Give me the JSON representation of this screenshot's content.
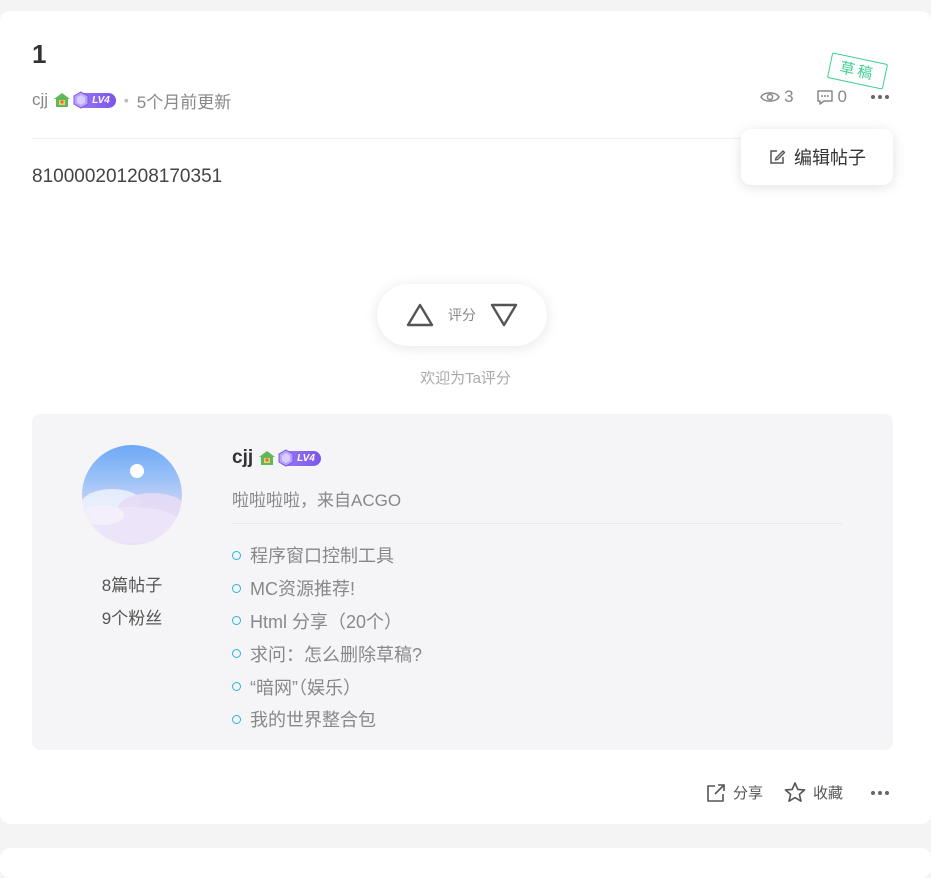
{
  "post": {
    "title": "1",
    "status_stamp": "草稿",
    "author": "cjj",
    "level_badge": "LV4",
    "updated": "5个月前更新",
    "views": "3",
    "comments": "0",
    "content": "810000201208170351"
  },
  "menu": {
    "edit_label": "编辑帖子"
  },
  "rating": {
    "label": "评分",
    "hint": "欢迎为Ta评分"
  },
  "author_card": {
    "name": "cjj",
    "level_badge": "LV4",
    "bio": "啦啦啦啦，来自ACGO",
    "posts_count": "8篇帖子",
    "fans_count": "9个粉丝",
    "recent_posts": [
      "程序窗口控制工具",
      "MC资源推荐!",
      "Html 分享（20个）",
      "求问：怎么删除草稿?",
      "“暗网”（娱乐）",
      "我的世界整合包"
    ]
  },
  "footer": {
    "share_label": "分享",
    "favorite_label": "收藏"
  },
  "colors": {
    "accent_cyan": "#2bb5d8",
    "stamp_green": "#3ecf8e",
    "level_purple": "#8a66ee"
  }
}
